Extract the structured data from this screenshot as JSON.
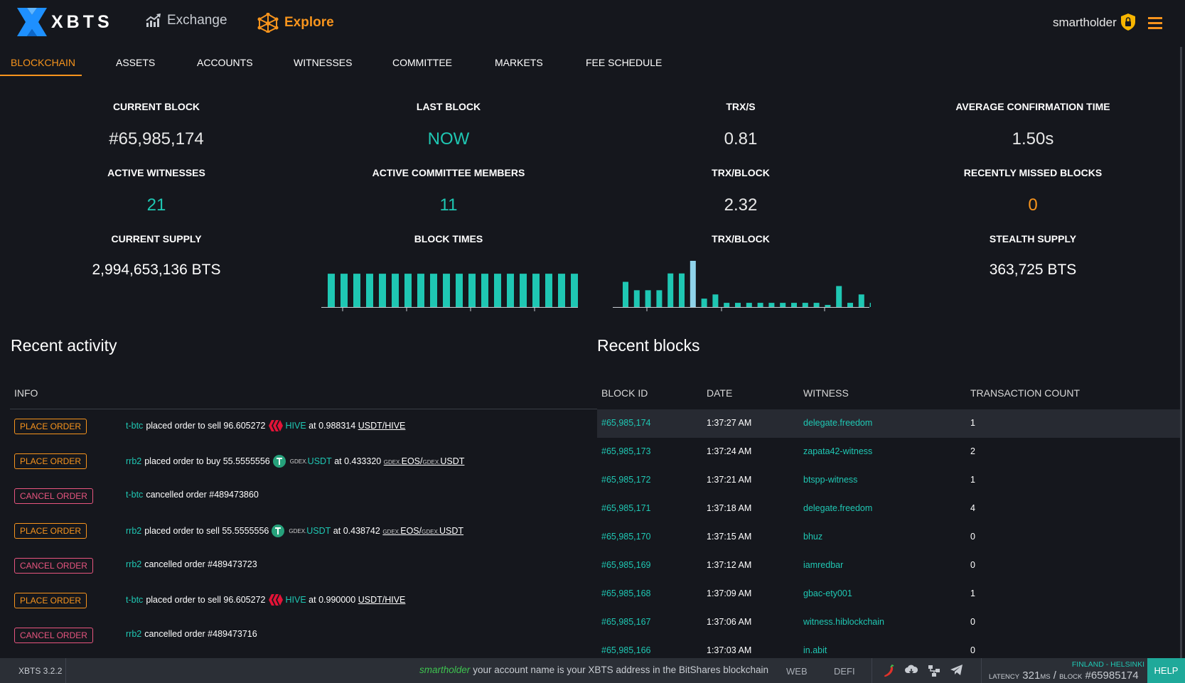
{
  "app": {
    "logo_text": "XBTS",
    "nav": {
      "exchange": "Exchange",
      "explore": "Explore"
    },
    "user": "smartholder"
  },
  "tabs": [
    {
      "label": "BLOCKCHAIN",
      "active": true
    },
    {
      "label": "ASSETS"
    },
    {
      "label": "ACCOUNTS"
    },
    {
      "label": "WITNESSES"
    },
    {
      "label": "COMMITTEE"
    },
    {
      "label": "MARKETS"
    },
    {
      "label": "FEE SCHEDULE"
    }
  ],
  "stats": {
    "current_block": {
      "label": "CURRENT BLOCK",
      "value": "#65,985,174"
    },
    "last_block": {
      "label": "LAST BLOCK",
      "value": "NOW"
    },
    "trx_s": {
      "label": "TRX/S",
      "value": "0.81"
    },
    "avg_conf": {
      "label": "AVERAGE CONFIRMATION TIME",
      "value": "1.50s"
    },
    "active_witnesses": {
      "label": "ACTIVE WITNESSES",
      "value": "21"
    },
    "active_committee": {
      "label": "ACTIVE COMMITTEE MEMBERS",
      "value": "11"
    },
    "trx_block": {
      "label": "TRX/BLOCK",
      "value": "2.32"
    },
    "missed": {
      "label": "RECENTLY MISSED BLOCKS",
      "value": "0"
    },
    "current_supply": {
      "label": "CURRENT SUPPLY",
      "value": "2,994,653,136 BTS"
    },
    "block_times_label": "BLOCK TIMES",
    "trx_block_chart_label": "TRX/BLOCK",
    "stealth_supply": {
      "label": "STEALTH SUPPLY",
      "value": "363,725 BTS"
    }
  },
  "chart_data": [
    {
      "type": "bar",
      "title": "BLOCK TIMES",
      "values": [
        3,
        3,
        3,
        3,
        3,
        3,
        3,
        3,
        3,
        3,
        3,
        3,
        3,
        3,
        3,
        3,
        3,
        3,
        3,
        3
      ],
      "ylim": [
        0,
        3.2
      ],
      "color": "#1fc7b3"
    },
    {
      "type": "bar",
      "title": "TRX/BLOCK",
      "values": [
        6,
        4,
        4,
        4,
        8,
        8,
        11,
        2,
        3,
        1,
        1,
        1,
        1,
        1,
        1,
        1,
        1,
        1,
        0.5,
        5,
        1,
        3,
        1
      ],
      "highlight_index": 6,
      "ylim": [
        0,
        11
      ],
      "color": "#1fc7b3",
      "highlight_color": "#8fd3ea"
    }
  ],
  "activity": {
    "title": "Recent activity",
    "column": "INFO",
    "rows": [
      {
        "type": "place",
        "badge": "PLACE ORDER",
        "account": "t-btc",
        "text": "placed order to sell 96.605272",
        "coin": "hive",
        "asset_prefix": "",
        "asset": "HIVE",
        "at": "at 0.988314",
        "market_prefix1": "",
        "market_a": "USDT/HIVE",
        "market_prefix2": "",
        "market_b": ""
      },
      {
        "type": "place",
        "badge": "PLACE ORDER",
        "account": "rrb2",
        "text": "placed order to buy 55.5555556",
        "coin": "tether",
        "asset_prefix": "GDEX.",
        "asset": "USDT",
        "at": "at 0.433320",
        "market_prefix1": "GDEX.",
        "market_a": "EOS/",
        "market_prefix2": "GDEX.",
        "market_b": "USDT"
      },
      {
        "type": "cancel",
        "badge": "CANCEL ORDER",
        "account": "t-btc",
        "text": "cancelled order #489473860"
      },
      {
        "type": "place",
        "badge": "PLACE ORDER",
        "account": "rrb2",
        "text": "placed order to sell 55.5555556",
        "coin": "tether",
        "asset_prefix": "GDEX.",
        "asset": "USDT",
        "at": "at 0.438742",
        "market_prefix1": "GDEX.",
        "market_a": "EOS/",
        "market_prefix2": "GDEX.",
        "market_b": "USDT"
      },
      {
        "type": "cancel",
        "badge": "CANCEL ORDER",
        "account": "rrb2",
        "text": "cancelled order #489473723"
      },
      {
        "type": "place",
        "badge": "PLACE ORDER",
        "account": "t-btc",
        "text": "placed order to sell 96.605272",
        "coin": "hive",
        "asset_prefix": "",
        "asset": "HIVE",
        "at": "at 0.990000",
        "market_prefix1": "",
        "market_a": "USDT/HIVE",
        "market_prefix2": "",
        "market_b": ""
      },
      {
        "type": "cancel",
        "badge": "CANCEL ORDER",
        "account": "rrb2",
        "text": "cancelled order #489473716"
      }
    ]
  },
  "blocks": {
    "title": "Recent blocks",
    "columns": [
      "BLOCK ID",
      "DATE",
      "WITNESS",
      "TRANSACTION COUNT"
    ],
    "rows": [
      {
        "id": "#65,985,174",
        "date": "1:37:27 AM",
        "witness": "delegate.freedom",
        "count": "1"
      },
      {
        "id": "#65,985,173",
        "date": "1:37:24 AM",
        "witness": "zapata42-witness",
        "count": "2"
      },
      {
        "id": "#65,985,172",
        "date": "1:37:21 AM",
        "witness": "btspp-witness",
        "count": "1"
      },
      {
        "id": "#65,985,171",
        "date": "1:37:18 AM",
        "witness": "delegate.freedom",
        "count": "4"
      },
      {
        "id": "#65,985,170",
        "date": "1:37:15 AM",
        "witness": "bhuz",
        "count": "0"
      },
      {
        "id": "#65,985,169",
        "date": "1:37:12 AM",
        "witness": "iamredbar",
        "count": "0"
      },
      {
        "id": "#65,985,168",
        "date": "1:37:09 AM",
        "witness": "gbac-ety001",
        "count": "1"
      },
      {
        "id": "#65,985,167",
        "date": "1:37:06 AM",
        "witness": "witness.hiblockchain",
        "count": "0"
      },
      {
        "id": "#65,985,166",
        "date": "1:37:03 AM",
        "witness": "in.abit",
        "count": "0"
      }
    ]
  },
  "footer": {
    "version": "XBTS 3.2.2",
    "notice_user": "smartholder",
    "notice_text": "your account name is your XBTS address in the BitShares blockchain",
    "web": "WEB",
    "defi": "DEFI",
    "location": "FINLAND - HELSINKI",
    "latency_label": "LATENCY",
    "latency_value": "321",
    "latency_unit": "MS",
    "block_label": "BLOCK",
    "block_value": "#65985174",
    "help": "HELP"
  },
  "colors": {
    "accent": "#f7941d",
    "teal": "#1fc7b3",
    "cancel": "#e8557f",
    "background": "#15171d"
  }
}
